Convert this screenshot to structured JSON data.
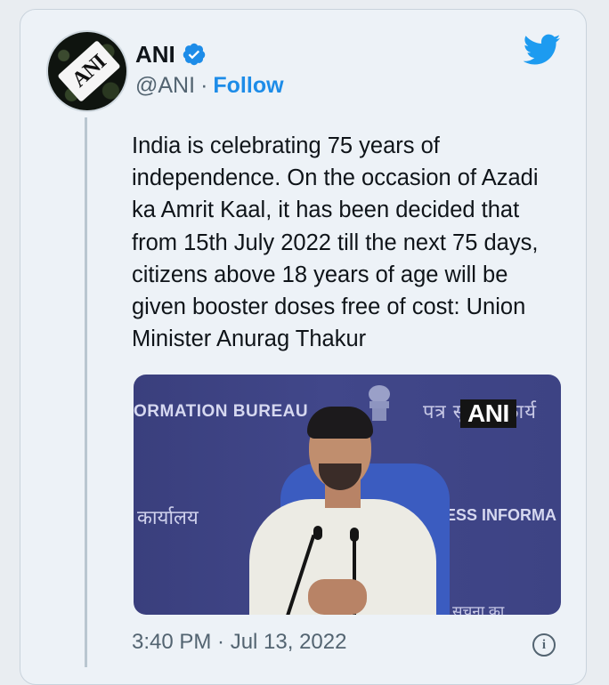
{
  "tweet": {
    "author_name": "ANI",
    "handle": "@ANI",
    "separator": "·",
    "follow_label": "Follow",
    "avatar_text": "ANI",
    "text": "India is celebrating 75 years of\nindependence. On the occasion of Azadi\nka Amrit Kaal, it has been decided that\nfrom 15th July 2022 till the next 75 days,\ncitizens above 18 years of age will be\ngiven booster doses free of cost: Union\nMinister Anurag Thakur",
    "timestamp": "3:40 PM · Jul 13, 2022",
    "info_icon_glyph": "i"
  },
  "media": {
    "watermark": "ANI",
    "wall_text_left": "ORMATION BUREAU",
    "wall_text_hindi_top": "पत्र सूचना कार्य",
    "wall_text_hindi_left": "कार्यालय",
    "wall_text_right": "ESS INFORMA",
    "wall_text_hindi_bottom": "सूचना का"
  },
  "colors": {
    "accent": "#1d8ce8",
    "text_primary": "#0f1419",
    "text_secondary": "#536471",
    "card_bg": "#edf2f7"
  },
  "icons": {
    "bird": "twitter-bird-icon",
    "verified": "verified-badge-icon",
    "info": "info-icon"
  }
}
